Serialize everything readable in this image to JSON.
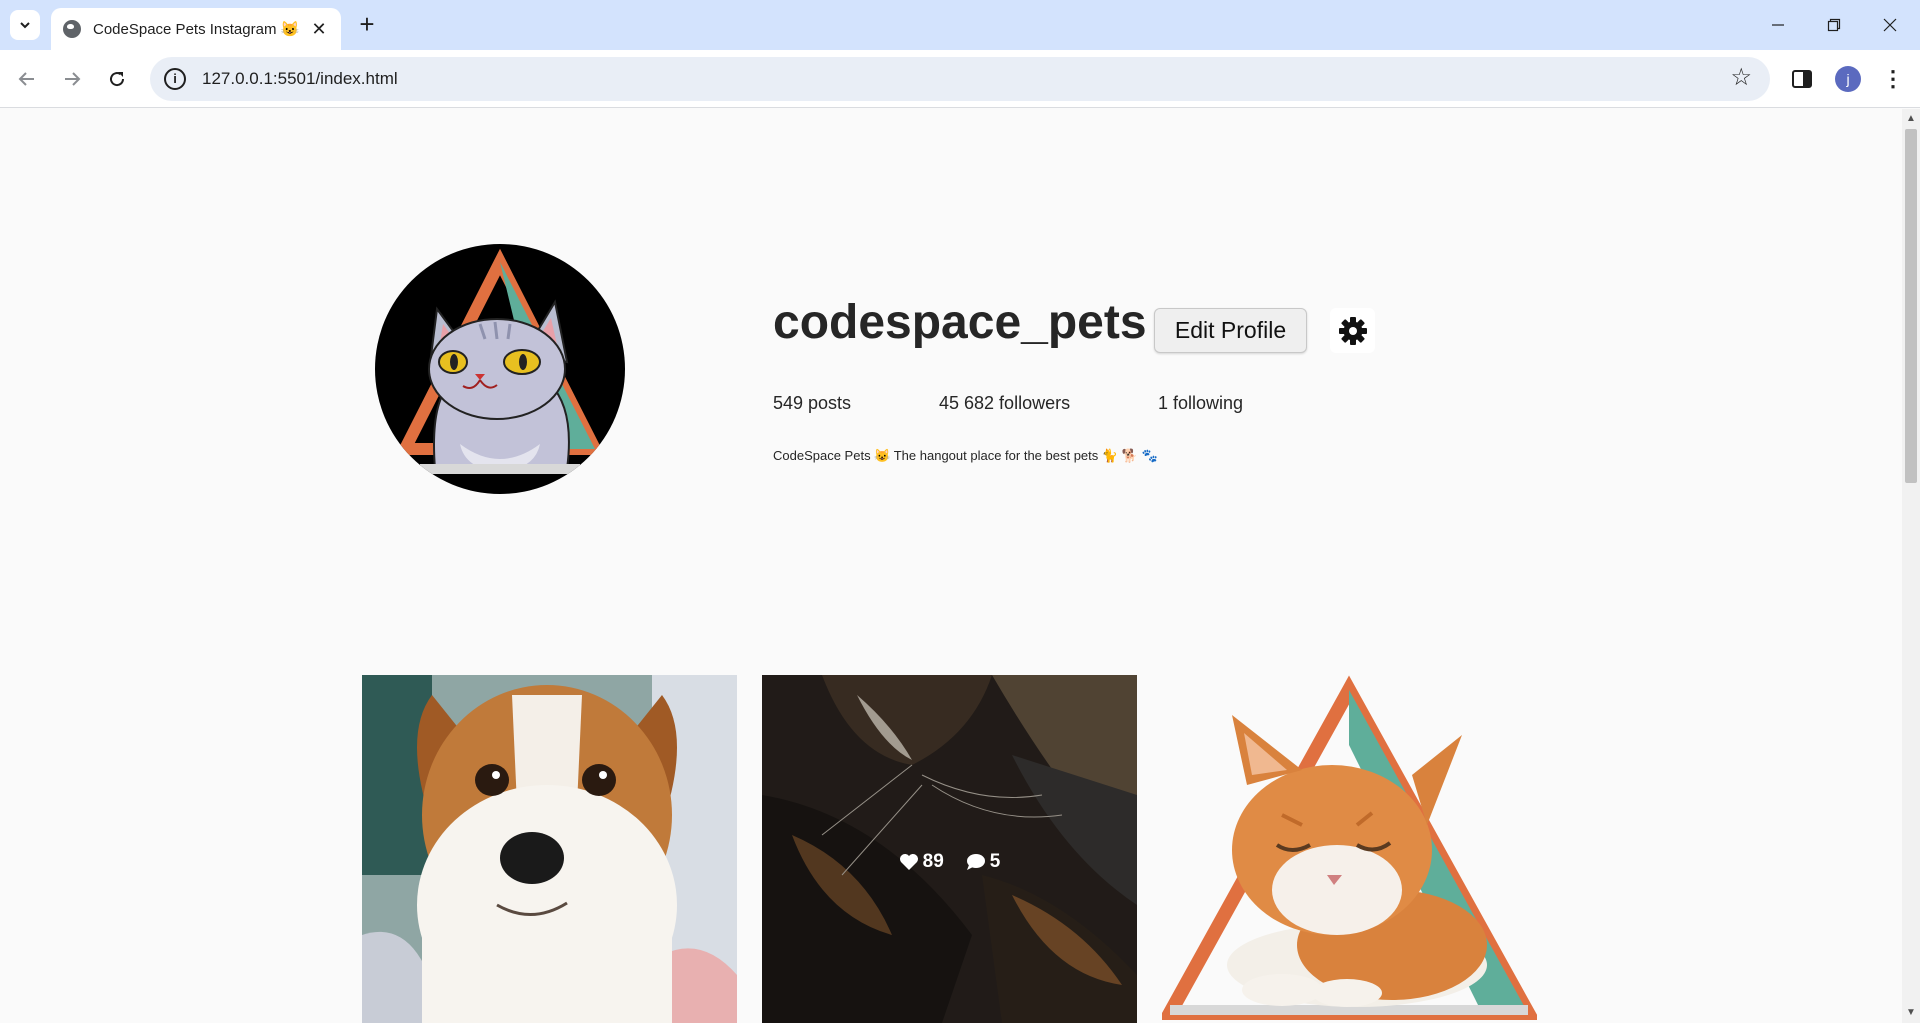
{
  "browser": {
    "tab_title": "CodeSpace Pets Instagram 😺",
    "url": "127.0.0.1:5501/index.html",
    "avatar_initial": "j"
  },
  "profile": {
    "username": "codespace_pets",
    "edit_button_label": "Edit Profile",
    "posts": "549 posts",
    "followers": "45 682 followers",
    "following": "1 following",
    "bio": "CodeSpace Pets 😺 The hangout place for the best pets 🐈 🐕 🐾"
  },
  "posts": [
    {
      "subject": "dog",
      "likes": "",
      "comments": ""
    },
    {
      "subject": "calico-cat",
      "likes": "89",
      "comments": "5"
    },
    {
      "subject": "orange-cat",
      "likes": "",
      "comments": ""
    }
  ],
  "colors": {
    "tabstrip": "#d3e3fd",
    "page_bg": "#fafafa",
    "triangle_orange": "#e07040",
    "triangle_teal": "#5fae9a"
  }
}
